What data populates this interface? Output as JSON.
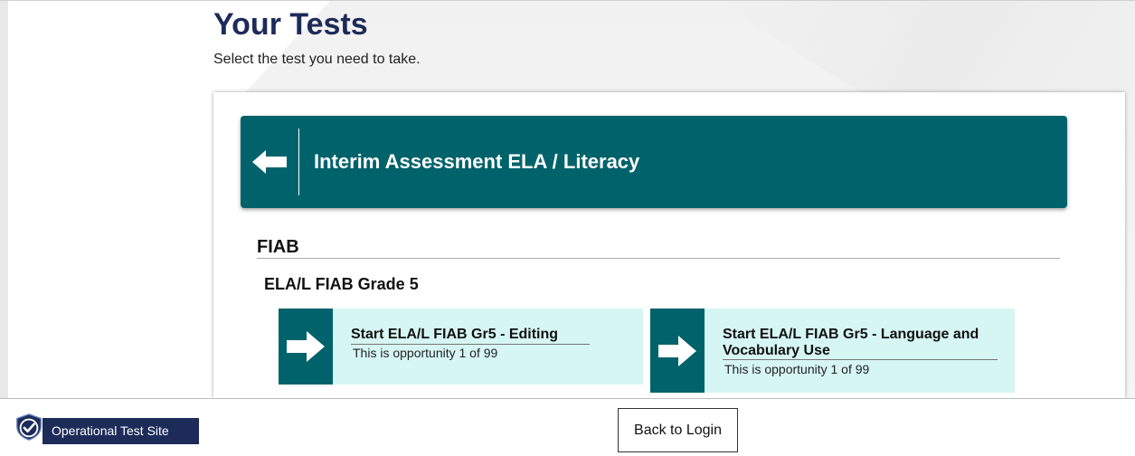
{
  "header": {
    "title": "Your Tests",
    "subtitle": "Select the test you need to take."
  },
  "banner": {
    "title": "Interim Assessment ELA / Literacy",
    "back_icon": "arrow-left-icon"
  },
  "section": {
    "title": "FIAB",
    "group_title": "ELA/L FIAB Grade 5"
  },
  "tests": [
    {
      "title": "Start ELA/L FIAB Gr5 - Editing",
      "opportunity": "This is opportunity 1 of 99",
      "icon": "arrow-right-icon"
    },
    {
      "title": "Start ELA/L FIAB Gr5 - Language and Vocabulary Use",
      "opportunity": "This is opportunity 1 of 99",
      "icon": "arrow-right-icon"
    }
  ],
  "footer": {
    "site_label": "Operational Test Site",
    "site_icon": "shield-check-icon",
    "back_to_login": "Back to Login"
  },
  "colors": {
    "brand_dark": "#1d2b59",
    "teal": "#00626a",
    "card_bg": "#d6f6f4"
  }
}
